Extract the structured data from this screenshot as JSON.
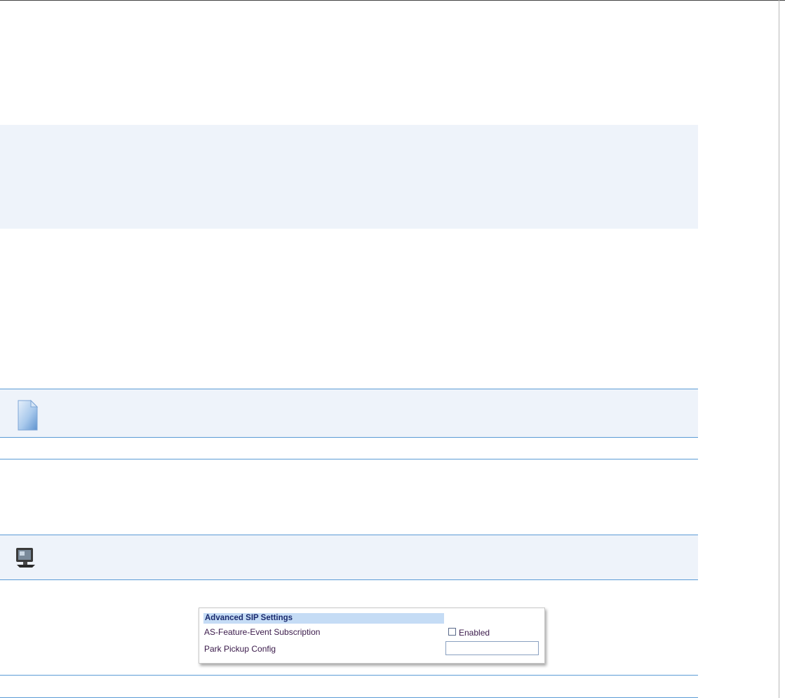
{
  "icons": {
    "note": "document-note-icon",
    "screen": "computer-monitor-icon"
  },
  "colors": {
    "rule_blue": "#5b9bd5",
    "box_fill": "#eef3fa",
    "header_fill": "#c5dcf5",
    "header_text": "#1a2a6e"
  },
  "advanced_sip": {
    "header": "Advanced SIP Settings",
    "feature_event_label": "AS-Feature-Event Subscription",
    "enabled_label": "Enabled",
    "enabled_checked": false,
    "park_pickup_label": "Park Pickup Config",
    "park_pickup_value": ""
  }
}
